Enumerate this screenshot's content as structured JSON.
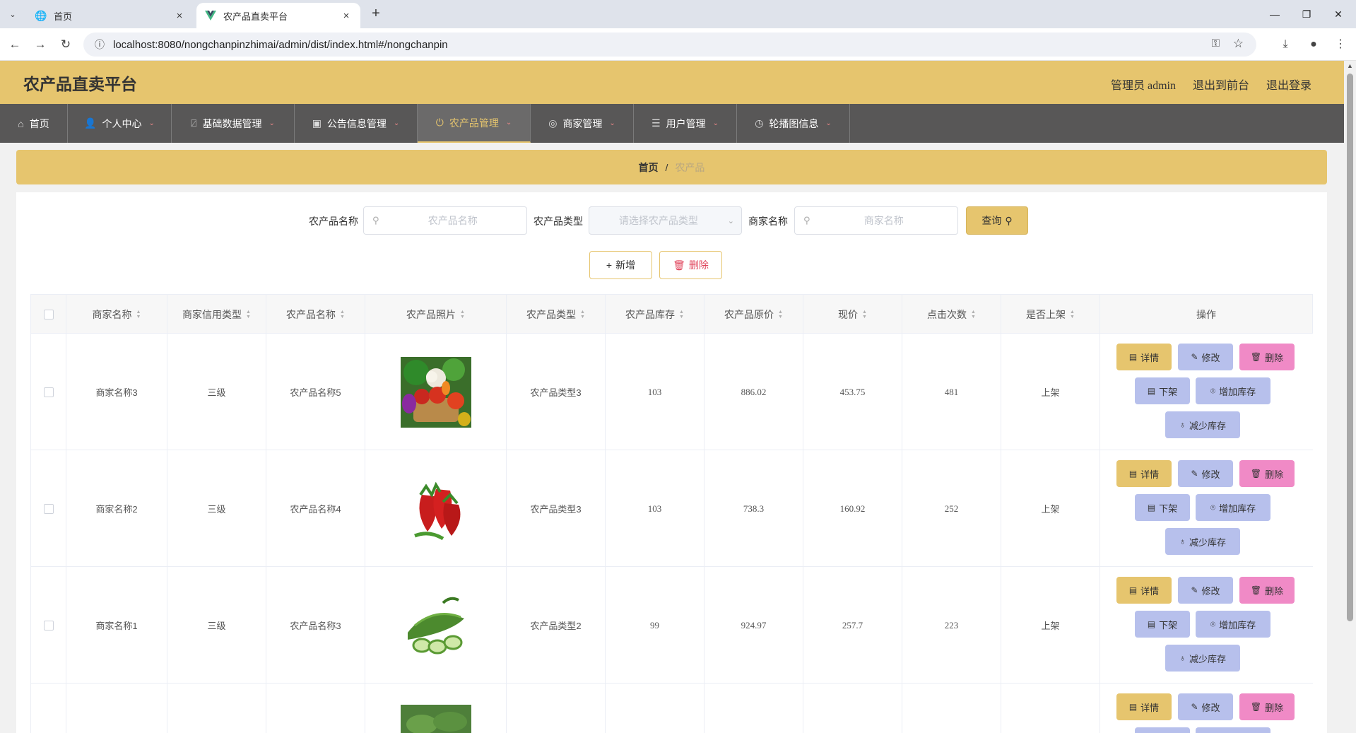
{
  "browser": {
    "tabs": [
      {
        "title": "首页",
        "active": false
      },
      {
        "title": "农产品直卖平台",
        "active": true
      }
    ],
    "url": "localhost:8080/nongchanpinzhimai/admin/dist/index.html#/nongchanpin"
  },
  "header": {
    "brand": "农产品直卖平台",
    "user": "管理员 admin",
    "to_front": "退出到前台",
    "logout": "退出登录"
  },
  "nav": [
    {
      "label": "首页",
      "icon": "home-icon"
    },
    {
      "label": "个人中心",
      "icon": "user-icon"
    },
    {
      "label": "基础数据管理",
      "icon": "data-icon"
    },
    {
      "label": "公告信息管理",
      "icon": "clipboard-icon"
    },
    {
      "label": "农产品管理",
      "icon": "power-icon"
    },
    {
      "label": "商家管理",
      "icon": "target-icon"
    },
    {
      "label": "用户管理",
      "icon": "sliders-icon"
    },
    {
      "label": "轮播图信息",
      "icon": "clock-icon"
    }
  ],
  "breadcrumb": {
    "home": "首页",
    "sep": "/",
    "current": "农产品"
  },
  "search": {
    "name_label": "农产品名称",
    "name_placeholder": "农产品名称",
    "type_label": "农产品类型",
    "type_placeholder": "请选择农产品类型",
    "merchant_label": "商家名称",
    "merchant_placeholder": "商家名称",
    "query_label": "查询"
  },
  "actions": {
    "add": "新增",
    "delete": "删除"
  },
  "table": {
    "columns": [
      "商家名称",
      "商家信用类型",
      "农产品名称",
      "农产品照片",
      "农产品类型",
      "农产品库存",
      "农产品原价",
      "现价",
      "点击次数",
      "是否上架",
      "操作"
    ],
    "rows": [
      {
        "merchant": "商家名称3",
        "credit": "三级",
        "name": "农产品名称5",
        "photo": "vegetables",
        "type": "农产品类型3",
        "stock": "103",
        "orig_price": "886.02",
        "price": "453.75",
        "clicks": "481",
        "on_shelf": "上架"
      },
      {
        "merchant": "商家名称2",
        "credit": "三级",
        "name": "农产品名称4",
        "photo": "strawberries",
        "type": "农产品类型3",
        "stock": "103",
        "orig_price": "738.3",
        "price": "160.92",
        "clicks": "252",
        "on_shelf": "上架"
      },
      {
        "merchant": "商家名称1",
        "credit": "三级",
        "name": "农产品名称3",
        "photo": "cucumber",
        "type": "农产品类型2",
        "stock": "99",
        "orig_price": "924.97",
        "price": "257.7",
        "clicks": "223",
        "on_shelf": "上架"
      },
      {
        "merchant": "",
        "credit": "",
        "name": "",
        "photo": "greens",
        "type": "",
        "stock": "",
        "orig_price": "",
        "price": "",
        "clicks": "",
        "on_shelf": ""
      }
    ],
    "ops": {
      "detail": "详情",
      "edit": "修改",
      "del": "删除",
      "down": "下架",
      "inc": "增加库存",
      "dec": "减少库存"
    }
  },
  "colors": {
    "accent": "#e6c56e",
    "nav_bg": "#585757",
    "op_blue": "#b7c0ec",
    "op_pink": "#f08ac6"
  }
}
